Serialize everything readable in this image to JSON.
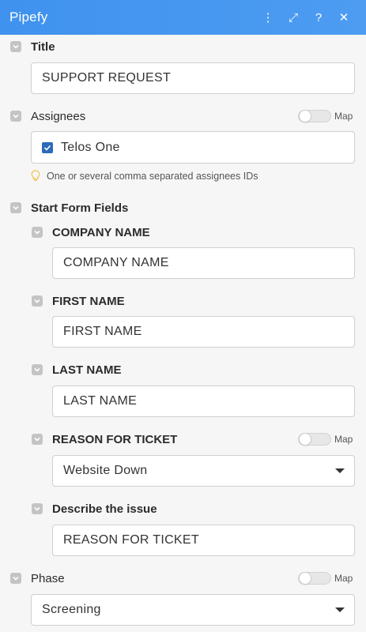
{
  "header": {
    "title": "Pipefy",
    "icons": [
      "more-vertical-icon",
      "expand-icon",
      "help-icon",
      "close-icon"
    ],
    "more_glyph": "⋮",
    "expand_glyph": "⤢",
    "help_glyph": "?",
    "close_glyph": "✕"
  },
  "title_section": {
    "label": "Title",
    "value": "SUPPORT REQUEST"
  },
  "assignees_section": {
    "label": "Assignees",
    "map_label": "Map",
    "selected": "Telos One",
    "hint": "One or several comma separated assignees IDs"
  },
  "start_form": {
    "label": "Start Form Fields",
    "fields": [
      {
        "label": "COMPANY NAME",
        "value": "COMPANY NAME"
      },
      {
        "label": "FIRST NAME",
        "value": "FIRST NAME"
      },
      {
        "label": "LAST NAME",
        "value": "LAST NAME"
      },
      {
        "label": "REASON FOR TICKET",
        "value": "Website Down",
        "map_label": "Map",
        "type": "select"
      },
      {
        "label": "Describe the issue",
        "value": "REASON FOR TICKET"
      }
    ]
  },
  "phase_section": {
    "label": "Phase",
    "map_label": "Map",
    "value": "Screening"
  },
  "colors": {
    "header": "#3f92ee",
    "checkbox": "#2d6bb8",
    "hint_icon": "#f2c14e"
  }
}
